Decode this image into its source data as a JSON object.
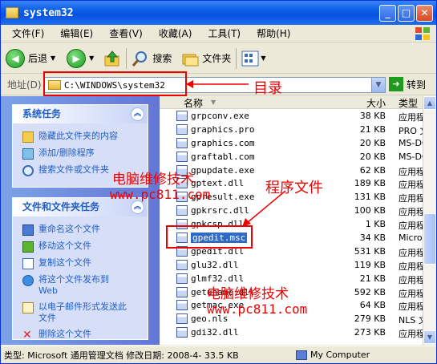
{
  "window": {
    "title": "system32"
  },
  "menu": [
    "文件(F)",
    "编辑(E)",
    "查看(V)",
    "收藏(A)",
    "工具(T)",
    "帮助(H)"
  ],
  "toolbar": {
    "back": "后退",
    "search": "搜索",
    "folders": "文件夹"
  },
  "address": {
    "label": "地址(D)",
    "path": "C:\\WINDOWS\\system32",
    "go": "转到"
  },
  "system_tasks": {
    "title": "系统任务",
    "items": [
      "隐藏此文件夹的内容",
      "添加/删除程序",
      "搜索文件或文件夹"
    ]
  },
  "file_tasks": {
    "title": "文件和文件夹任务",
    "items": [
      "重命名这个文件",
      "移动这个文件",
      "复制这个文件",
      "将这个文件发布到 Web",
      "以电子邮件形式发送此文件",
      "删除这个文件"
    ]
  },
  "columns": {
    "name": "名称",
    "size": "大小",
    "type": "类型"
  },
  "files": [
    {
      "name": "grpconv.exe",
      "size": "38 KB",
      "type": "应用程"
    },
    {
      "name": "graphics.pro",
      "size": "21 KB",
      "type": "PRO 文"
    },
    {
      "name": "graphics.com",
      "size": "20 KB",
      "type": "MS-DO"
    },
    {
      "name": "graftabl.com",
      "size": "20 KB",
      "type": "MS-DO"
    },
    {
      "name": "gpupdate.exe",
      "size": "62 KB",
      "type": "应用程"
    },
    {
      "name": "gptext.dll",
      "size": "189 KB",
      "type": "应用程"
    },
    {
      "name": "gpresult.exe",
      "size": "131 KB",
      "type": "应用程"
    },
    {
      "name": "gpkrsrc.dll",
      "size": "100 KB",
      "type": "应用程"
    },
    {
      "name": "gpkcsp.dll",
      "size": "1 KB",
      "type": "应用程"
    },
    {
      "name": "gpedit.msc",
      "size": "34 KB",
      "type": "Micro"
    },
    {
      "name": "gpedit.dll",
      "size": "531 KB",
      "type": "应用程"
    },
    {
      "name": "glu32.dll",
      "size": "119 KB",
      "type": "应用程"
    },
    {
      "name": "glmf32.dll",
      "size": "21 KB",
      "type": "应用程"
    },
    {
      "name": "getuname.dll",
      "size": "592 KB",
      "type": "应用程"
    },
    {
      "name": "getmac.exe",
      "size": "64 KB",
      "type": "应用程"
    },
    {
      "name": "geo.nls",
      "size": "279 KB",
      "type": "NLS 文"
    },
    {
      "name": "gdi32.dll",
      "size": "273 KB",
      "type": "应用程"
    }
  ],
  "status": {
    "text": "类型: Microsoft 通用管理文档 修改日期: 2008-4- 33.5 KB",
    "location": "My Computer"
  },
  "annotations": {
    "dir": "目录",
    "program": "程序文件",
    "watermark1": "电脑维修技术",
    "watermark1_url": "www.pc811.com",
    "watermark2": "电脑维修技术",
    "watermark2_url": "www.pc811.com"
  },
  "colors": {
    "title_blue": "#0a5ee8",
    "task_blue": "#215dc6",
    "annotation_red": "#ee0000",
    "select": "#316ac5"
  }
}
